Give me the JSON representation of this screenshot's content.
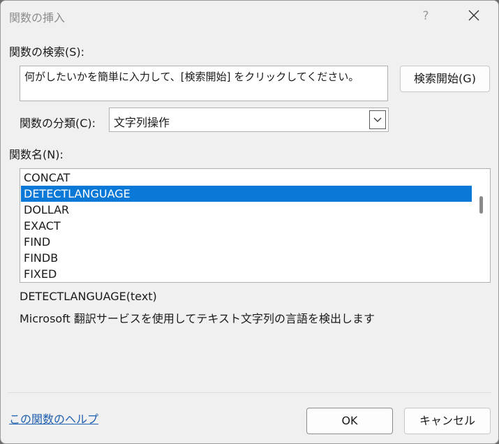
{
  "dialog": {
    "title": "関数の挿入",
    "help_icon": "?",
    "close_icon": "close-icon"
  },
  "search": {
    "label": "関数の検索(S):",
    "value": "何がしたいかを簡単に入力して、[検索開始] をクリックしてください。",
    "button_label": "検索開始(G)"
  },
  "category": {
    "label": "関数の分類(C):",
    "selected": "文字列操作"
  },
  "functions": {
    "label": "関数名(N):",
    "items": [
      "CONCAT",
      "DETECTLANGUAGE",
      "DOLLAR",
      "EXACT",
      "FIND",
      "FINDB",
      "FIXED"
    ],
    "selected_index": 1
  },
  "description": {
    "signature": "DETECTLANGUAGE(text)",
    "text": "Microsoft 翻訳サービスを使用してテキスト文字列の言語を検出します"
  },
  "footer": {
    "help_link": "この関数のヘルプ",
    "ok_label": "OK",
    "cancel_label": "キャンセル"
  },
  "colors": {
    "selection": "#0a78d7",
    "link": "#1f5fb0",
    "background": "#f0f0f0"
  }
}
